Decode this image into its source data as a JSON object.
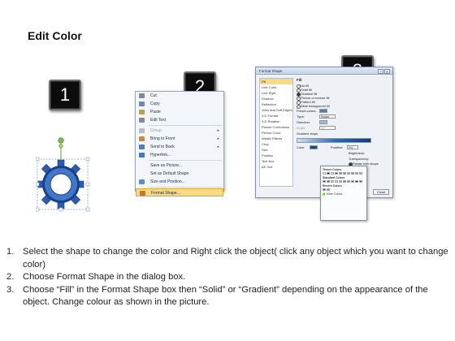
{
  "page": {
    "title": "Edit Color"
  },
  "steps": [
    "1",
    "2",
    "3"
  ],
  "context_menu": {
    "items": [
      {
        "label": "Cut",
        "icon": "scissors-icon",
        "color": "#7a8aa6",
        "disabled": false,
        "submenu": false
      },
      {
        "label": "Copy",
        "icon": "copy-icon",
        "color": "#6d86b5",
        "disabled": false,
        "submenu": false
      },
      {
        "label": "Paste",
        "icon": "paste-icon",
        "color": "#c79a4a",
        "disabled": false,
        "submenu": false
      },
      {
        "label": "Edit Text",
        "icon": "edit-text-icon",
        "color": "#8a8a8a",
        "disabled": false,
        "submenu": false
      },
      {
        "label": "Group",
        "icon": "group-icon",
        "color": "#b8bec8",
        "disabled": true,
        "submenu": true
      },
      {
        "label": "Bring to Front",
        "icon": "bring-front-icon",
        "color": "#d08a2e",
        "disabled": false,
        "submenu": true
      },
      {
        "label": "Send to Back",
        "icon": "send-back-icon",
        "color": "#4f7cc0",
        "disabled": false,
        "submenu": true
      },
      {
        "label": "Hyperlink...",
        "icon": "hyperlink-icon",
        "color": "#3a78c8",
        "disabled": false,
        "submenu": false
      },
      {
        "label": "Save as Picture...",
        "icon": "",
        "color": "",
        "disabled": false,
        "submenu": false
      },
      {
        "label": "Set as Default Shape",
        "icon": "",
        "color": "",
        "disabled": false,
        "submenu": false
      },
      {
        "label": "Size and Position...",
        "icon": "size-position-icon",
        "color": "#5d8fcf",
        "disabled": false,
        "submenu": false
      },
      {
        "label": "Format Shape...",
        "icon": "format-shape-icon",
        "color": "#c9772e",
        "disabled": false,
        "submenu": false,
        "highlight": true
      }
    ]
  },
  "dialog": {
    "title": "Format Shape",
    "nav": [
      "Fill",
      "Line Color",
      "Line Style",
      "Shadow",
      "Reflection",
      "Glow and Soft Edges",
      "3-D Format",
      "3-D Rotation",
      "Picture Corrections",
      "Picture Color",
      "Artistic Effects",
      "Crop",
      "Size",
      "Position",
      "Text Box",
      "Alt Text"
    ],
    "fill_heading": "Fill",
    "fill_options": [
      {
        "label": "No fill",
        "checked": false
      },
      {
        "label": "Solid fill",
        "checked": false
      },
      {
        "label": "Gradient fill",
        "checked": true
      },
      {
        "label": "Picture or texture fill",
        "checked": false
      },
      {
        "label": "Pattern fill",
        "checked": false
      },
      {
        "label": "Slide background fill",
        "checked": false
      }
    ],
    "fields": [
      "Preset colors:",
      "Type:",
      "Direction:",
      "Angle:",
      "Gradient stops"
    ],
    "type_value": "Radial",
    "angle_value": "90°",
    "color_label": "Color",
    "position_label": "Position:",
    "position_value": "0%",
    "brightness_label": "Brightness:",
    "transparency_label": "Transparency:",
    "rotate_label": "Rotate with shape",
    "close_label": "Close"
  },
  "palette": {
    "theme_heading": "Theme Colors",
    "standard_heading": "Standard Colors",
    "recent_heading": "Recent Colors",
    "more_label": "More Colors...",
    "theme_colors": [
      "#ffffff",
      "#000000",
      "#eeece1",
      "#1f497d",
      "#4f81bd",
      "#c0504d",
      "#9bbb59",
      "#8064a2",
      "#4bacc6",
      "#f79646"
    ],
    "standard_colors": [
      "#c00000",
      "#ff0000",
      "#ffc000",
      "#ffff00",
      "#92d050",
      "#00b050",
      "#00b0f0",
      "#0070c0",
      "#002060",
      "#7030a0"
    ],
    "recent_colors": [
      "#1f3a7a",
      "#4f81bd"
    ]
  },
  "instructions": [
    {
      "num": "1.",
      "text": "Select the shape to change the color and Right click the object( click any object which you want to change color)"
    },
    {
      "num": "2.",
      "text": "Choose Format Shape in the dialog box."
    },
    {
      "num": "3.",
      "text": "Choose “Fill” in the Format Shape box then “Solid” or “Gradient” depending on the appearance of the object. Change colour as shown in the picture."
    }
  ],
  "colors": {
    "gear_dark": "#1c3f8a",
    "gear_light": "#3f78c8",
    "highlight": "#f7da82"
  }
}
